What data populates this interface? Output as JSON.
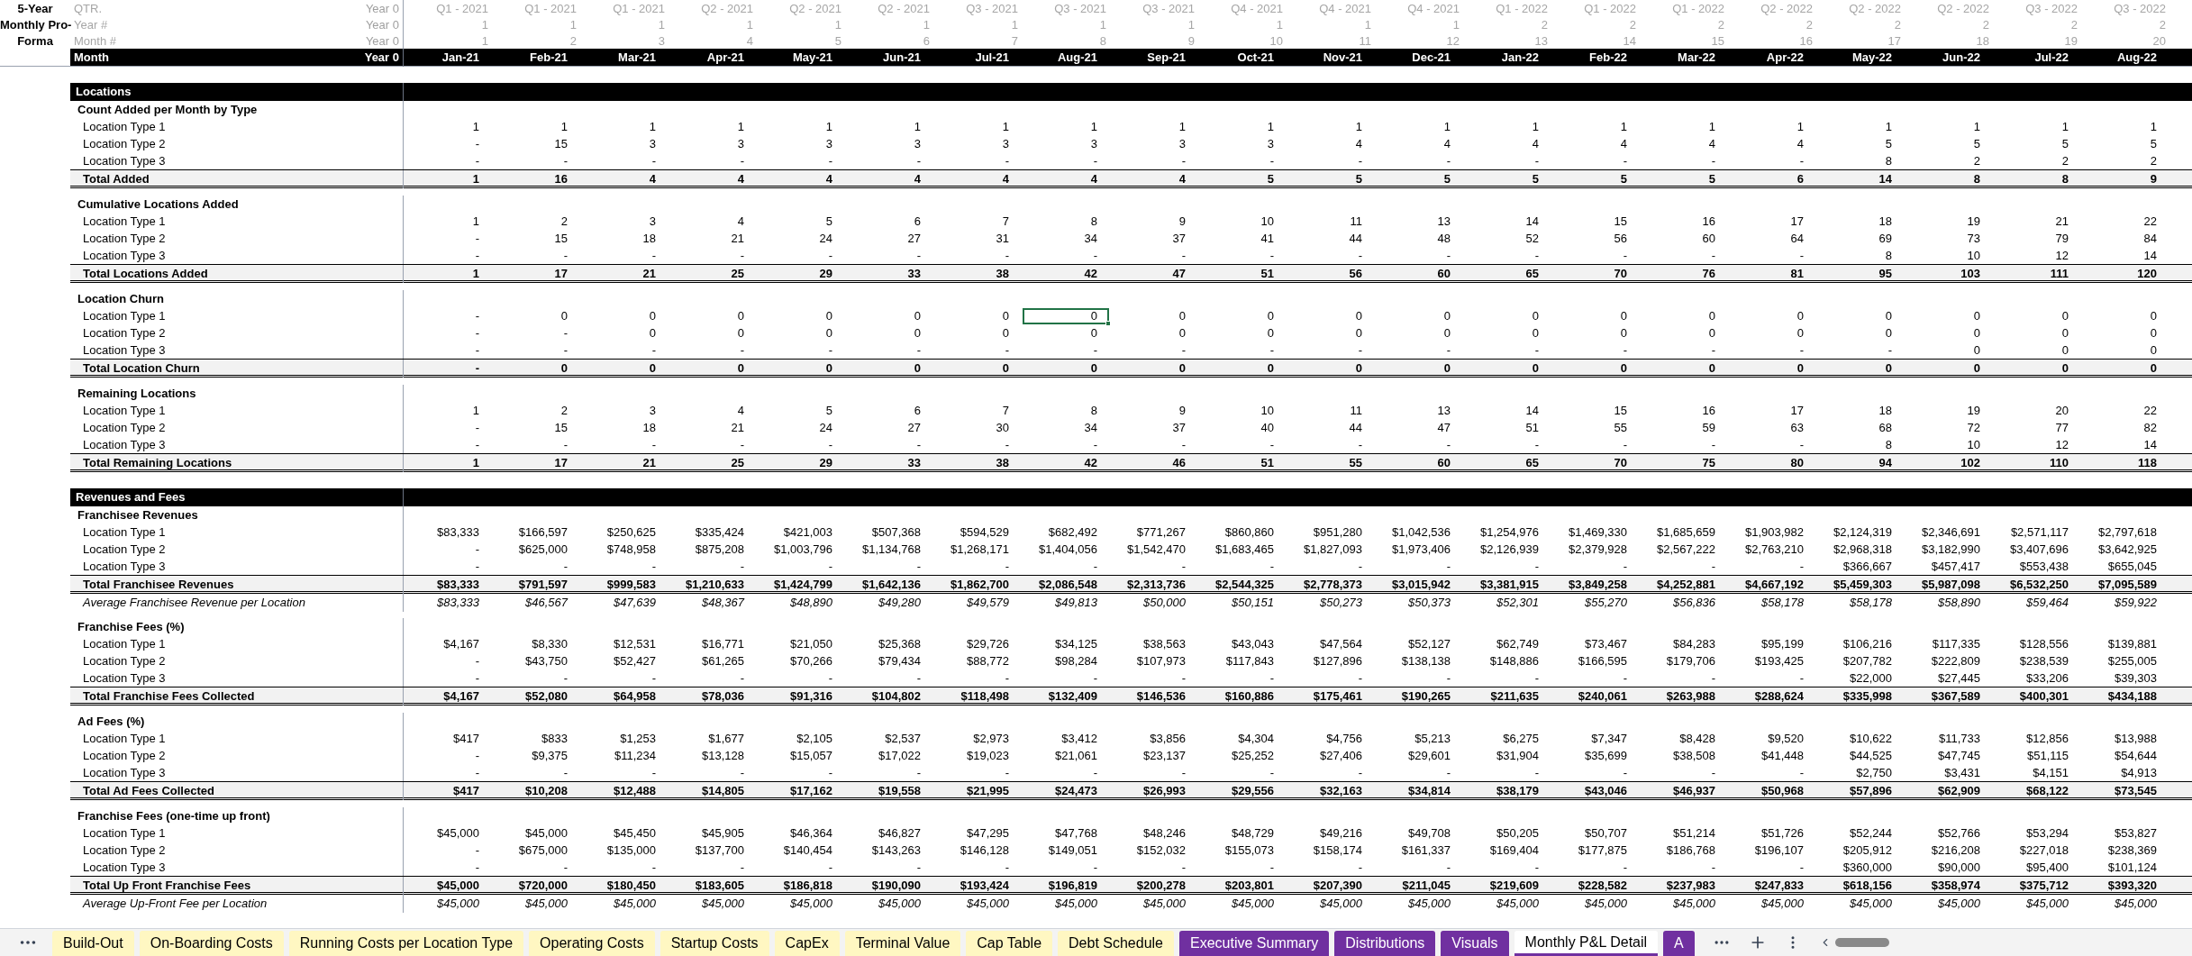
{
  "corner_title": [
    "5-Year",
    "Monthly Pro-",
    "Forma"
  ],
  "header_rows": [
    {
      "label": "QTR.",
      "year0": "Year 0",
      "values": [
        "Q1 - 2021",
        "Q1 - 2021",
        "Q1 - 2021",
        "Q2 - 2021",
        "Q2 - 2021",
        "Q2 - 2021",
        "Q3 - 2021",
        "Q3 - 2021",
        "Q3 - 2021",
        "Q4 - 2021",
        "Q4 - 2021",
        "Q4 - 2021",
        "Q1 - 2022",
        "Q1 - 2022",
        "Q1 - 2022",
        "Q2 - 2022",
        "Q2 - 2022",
        "Q2 - 2022",
        "Q3 - 2022",
        "Q3 - 2022"
      ]
    },
    {
      "label": "Year #",
      "year0": "Year 0",
      "values": [
        "1",
        "1",
        "1",
        "1",
        "1",
        "1",
        "1",
        "1",
        "1",
        "1",
        "1",
        "1",
        "2",
        "2",
        "2",
        "2",
        "2",
        "2",
        "2",
        "2"
      ]
    },
    {
      "label": "Month #",
      "year0": "Year 0",
      "values": [
        "1",
        "2",
        "3",
        "4",
        "5",
        "6",
        "7",
        "8",
        "9",
        "10",
        "11",
        "12",
        "13",
        "14",
        "15",
        "16",
        "17",
        "18",
        "19",
        "20"
      ]
    }
  ],
  "month_row": {
    "label": "Month",
    "year0": "Year 0",
    "values": [
      "Jan-21",
      "Feb-21",
      "Mar-21",
      "Apr-21",
      "May-21",
      "Jun-21",
      "Jul-21",
      "Aug-21",
      "Sep-21",
      "Oct-21",
      "Nov-21",
      "Dec-21",
      "Jan-22",
      "Feb-22",
      "Mar-22",
      "Apr-22",
      "May-22",
      "Jun-22",
      "Jul-22",
      "Aug-22"
    ]
  },
  "sections": [
    {
      "title": "Locations",
      "groups": [
        {
          "title": "Count Added per Month by Type",
          "rows": [
            {
              "kind": "item",
              "label": "Location Type 1",
              "values": [
                "1",
                "1",
                "1",
                "1",
                "1",
                "1",
                "1",
                "1",
                "1",
                "1",
                "1",
                "1",
                "1",
                "1",
                "1",
                "1",
                "1",
                "1",
                "1",
                "1"
              ]
            },
            {
              "kind": "item",
              "label": "Location Type 2",
              "values": [
                "-",
                "15",
                "3",
                "3",
                "3",
                "3",
                "3",
                "3",
                "3",
                "3",
                "4",
                "4",
                "4",
                "4",
                "4",
                "4",
                "5",
                "5",
                "5",
                "5"
              ]
            },
            {
              "kind": "item",
              "label": "Location Type 3",
              "values": [
                "-",
                "-",
                "-",
                "-",
                "-",
                "-",
                "-",
                "-",
                "-",
                "-",
                "-",
                "-",
                "-",
                "-",
                "-",
                "-",
                "8",
                "2",
                "2",
                "2"
              ]
            },
            {
              "kind": "total",
              "label": "Total Added",
              "values": [
                "1",
                "16",
                "4",
                "4",
                "4",
                "4",
                "4",
                "4",
                "4",
                "5",
                "5",
                "5",
                "5",
                "5",
                "5",
                "6",
                "14",
                "8",
                "8",
                "9"
              ]
            }
          ]
        },
        {
          "title": "Cumulative Locations Added",
          "rows": [
            {
              "kind": "item",
              "label": "Location Type 1",
              "values": [
                "1",
                "2",
                "3",
                "4",
                "5",
                "6",
                "7",
                "8",
                "9",
                "10",
                "11",
                "13",
                "14",
                "15",
                "16",
                "17",
                "18",
                "19",
                "21",
                "22"
              ]
            },
            {
              "kind": "item",
              "label": "Location Type 2",
              "values": [
                "-",
                "15",
                "18",
                "21",
                "24",
                "27",
                "31",
                "34",
                "37",
                "41",
                "44",
                "48",
                "52",
                "56",
                "60",
                "64",
                "69",
                "73",
                "79",
                "84"
              ]
            },
            {
              "kind": "item",
              "label": "Location Type 3",
              "values": [
                "-",
                "-",
                "-",
                "-",
                "-",
                "-",
                "-",
                "-",
                "-",
                "-",
                "-",
                "-",
                "-",
                "-",
                "-",
                "-",
                "8",
                "10",
                "12",
                "14"
              ]
            },
            {
              "kind": "total",
              "label": "Total Locations Added",
              "values": [
                "1",
                "17",
                "21",
                "25",
                "29",
                "33",
                "38",
                "42",
                "47",
                "51",
                "56",
                "60",
                "65",
                "70",
                "76",
                "81",
                "95",
                "103",
                "111",
                "120"
              ]
            }
          ]
        },
        {
          "title": "Location Churn",
          "rows": [
            {
              "kind": "item",
              "label": "Location Type 1",
              "values": [
                "-",
                "0",
                "0",
                "0",
                "0",
                "0",
                "0",
                "0",
                "0",
                "0",
                "0",
                "0",
                "0",
                "0",
                "0",
                "0",
                "0",
                "0",
                "0",
                "0"
              ],
              "selected_cells": [
                false,
                false,
                false,
                false,
                false,
                false,
                false,
                true,
                false,
                false,
                false,
                false,
                false,
                false,
                false,
                false,
                false,
                false,
                false,
                false
              ]
            },
            {
              "kind": "item",
              "label": "Location Type 2",
              "values": [
                "-",
                "-",
                "0",
                "0",
                "0",
                "0",
                "0",
                "0",
                "0",
                "0",
                "0",
                "0",
                "0",
                "0",
                "0",
                "0",
                "0",
                "0",
                "0",
                "0"
              ]
            },
            {
              "kind": "item",
              "label": "Location Type 3",
              "values": [
                "-",
                "-",
                "-",
                "-",
                "-",
                "-",
                "-",
                "-",
                "-",
                "-",
                "-",
                "-",
                "-",
                "-",
                "-",
                "-",
                "-",
                "0",
                "0",
                "0"
              ]
            },
            {
              "kind": "total",
              "label": "Total Location Churn",
              "values": [
                "-",
                "0",
                "0",
                "0",
                "0",
                "0",
                "0",
                "0",
                "0",
                "0",
                "0",
                "0",
                "0",
                "0",
                "0",
                "0",
                "0",
                "0",
                "0",
                "0"
              ]
            }
          ]
        },
        {
          "title": "Remaining Locations",
          "rows": [
            {
              "kind": "item",
              "label": "Location Type 1",
              "values": [
                "1",
                "2",
                "3",
                "4",
                "5",
                "6",
                "7",
                "8",
                "9",
                "10",
                "11",
                "13",
                "14",
                "15",
                "16",
                "17",
                "18",
                "19",
                "20",
                "22"
              ]
            },
            {
              "kind": "item",
              "label": "Location Type 2",
              "values": [
                "-",
                "15",
                "18",
                "21",
                "24",
                "27",
                "30",
                "34",
                "37",
                "40",
                "44",
                "47",
                "51",
                "55",
                "59",
                "63",
                "68",
                "72",
                "77",
                "82"
              ]
            },
            {
              "kind": "item",
              "label": "Location Type 3",
              "values": [
                "-",
                "-",
                "-",
                "-",
                "-",
                "-",
                "-",
                "-",
                "-",
                "-",
                "-",
                "-",
                "-",
                "-",
                "-",
                "-",
                "8",
                "10",
                "12",
                "14"
              ]
            },
            {
              "kind": "total",
              "label": "Total Remaining Locations",
              "values": [
                "1",
                "17",
                "21",
                "25",
                "29",
                "33",
                "38",
                "42",
                "46",
                "51",
                "55",
                "60",
                "65",
                "70",
                "75",
                "80",
                "94",
                "102",
                "110",
                "118"
              ]
            }
          ]
        }
      ]
    },
    {
      "title": "Revenues and Fees",
      "groups": [
        {
          "title": "Franchisee Revenues",
          "rows": [
            {
              "kind": "item",
              "label": "Location Type 1",
              "values": [
                "$83,333",
                "$166,597",
                "$250,625",
                "$335,424",
                "$421,003",
                "$507,368",
                "$594,529",
                "$682,492",
                "$771,267",
                "$860,860",
                "$951,280",
                "$1,042,536",
                "$1,254,976",
                "$1,469,330",
                "$1,685,659",
                "$1,903,982",
                "$2,124,319",
                "$2,346,691",
                "$2,571,117",
                "$2,797,618"
              ]
            },
            {
              "kind": "item",
              "label": "Location Type 2",
              "values": [
                "-",
                "$625,000",
                "$748,958",
                "$875,208",
                "$1,003,796",
                "$1,134,768",
                "$1,268,171",
                "$1,404,056",
                "$1,542,470",
                "$1,683,465",
                "$1,827,093",
                "$1,973,406",
                "$2,126,939",
                "$2,379,928",
                "$2,567,222",
                "$2,763,210",
                "$2,968,318",
                "$3,182,990",
                "$3,407,696",
                "$3,642,925"
              ]
            },
            {
              "kind": "item",
              "label": "Location Type 3",
              "values": [
                "-",
                "-",
                "-",
                "-",
                "-",
                "-",
                "-",
                "-",
                "-",
                "-",
                "-",
                "-",
                "-",
                "-",
                "-",
                "-",
                "$366,667",
                "$457,417",
                "$553,438",
                "$655,045"
              ]
            },
            {
              "kind": "total",
              "label": "Total Franchisee Revenues",
              "values": [
                "$83,333",
                "$791,597",
                "$999,583",
                "$1,210,633",
                "$1,424,799",
                "$1,642,136",
                "$1,862,700",
                "$2,086,548",
                "$2,313,736",
                "$2,544,325",
                "$2,778,373",
                "$3,015,942",
                "$3,381,915",
                "$3,849,258",
                "$4,252,881",
                "$4,667,192",
                "$5,459,303",
                "$5,987,098",
                "$6,532,250",
                "$7,095,589"
              ]
            },
            {
              "kind": "average",
              "label": "Average Franchisee Revenue per Location",
              "values": [
                "$83,333",
                "$46,567",
                "$47,639",
                "$48,367",
                "$48,890",
                "$49,280",
                "$49,579",
                "$49,813",
                "$50,000",
                "$50,151",
                "$50,273",
                "$50,373",
                "$52,301",
                "$55,270",
                "$56,836",
                "$58,178",
                "$58,178",
                "$58,890",
                "$59,464",
                "$59,922"
              ]
            }
          ]
        },
        {
          "title": "Franchise Fees (%)",
          "rows": [
            {
              "kind": "item",
              "label": "Location Type 1",
              "values": [
                "$4,167",
                "$8,330",
                "$12,531",
                "$16,771",
                "$21,050",
                "$25,368",
                "$29,726",
                "$34,125",
                "$38,563",
                "$43,043",
                "$47,564",
                "$52,127",
                "$62,749",
                "$73,467",
                "$84,283",
                "$95,199",
                "$106,216",
                "$117,335",
                "$128,556",
                "$139,881"
              ]
            },
            {
              "kind": "item",
              "label": "Location Type 2",
              "values": [
                "-",
                "$43,750",
                "$52,427",
                "$61,265",
                "$70,266",
                "$79,434",
                "$88,772",
                "$98,284",
                "$107,973",
                "$117,843",
                "$127,896",
                "$138,138",
                "$148,886",
                "$166,595",
                "$179,706",
                "$193,425",
                "$207,782",
                "$222,809",
                "$238,539",
                "$255,005"
              ]
            },
            {
              "kind": "item",
              "label": "Location Type 3",
              "values": [
                "-",
                "-",
                "-",
                "-",
                "-",
                "-",
                "-",
                "-",
                "-",
                "-",
                "-",
                "-",
                "-",
                "-",
                "-",
                "-",
                "$22,000",
                "$27,445",
                "$33,206",
                "$39,303"
              ]
            },
            {
              "kind": "total",
              "label": "Total Franchise Fees Collected",
              "values": [
                "$4,167",
                "$52,080",
                "$64,958",
                "$78,036",
                "$91,316",
                "$104,802",
                "$118,498",
                "$132,409",
                "$146,536",
                "$160,886",
                "$175,461",
                "$190,265",
                "$211,635",
                "$240,061",
                "$263,988",
                "$288,624",
                "$335,998",
                "$367,589",
                "$400,301",
                "$434,188"
              ]
            }
          ]
        },
        {
          "title": "Ad Fees (%)",
          "rows": [
            {
              "kind": "item",
              "label": "Location Type 1",
              "values": [
                "$417",
                "$833",
                "$1,253",
                "$1,677",
                "$2,105",
                "$2,537",
                "$2,973",
                "$3,412",
                "$3,856",
                "$4,304",
                "$4,756",
                "$5,213",
                "$6,275",
                "$7,347",
                "$8,428",
                "$9,520",
                "$10,622",
                "$11,733",
                "$12,856",
                "$13,988"
              ]
            },
            {
              "kind": "item",
              "label": "Location Type 2",
              "values": [
                "-",
                "$9,375",
                "$11,234",
                "$13,128",
                "$15,057",
                "$17,022",
                "$19,023",
                "$21,061",
                "$23,137",
                "$25,252",
                "$27,406",
                "$29,601",
                "$31,904",
                "$35,699",
                "$38,508",
                "$41,448",
                "$44,525",
                "$47,745",
                "$51,115",
                "$54,644"
              ]
            },
            {
              "kind": "item",
              "label": "Location Type 3",
              "values": [
                "-",
                "-",
                "-",
                "-",
                "-",
                "-",
                "-",
                "-",
                "-",
                "-",
                "-",
                "-",
                "-",
                "-",
                "-",
                "-",
                "$2,750",
                "$3,431",
                "$4,151",
                "$4,913"
              ]
            },
            {
              "kind": "total",
              "label": "Total Ad Fees Collected",
              "values": [
                "$417",
                "$10,208",
                "$12,488",
                "$14,805",
                "$17,162",
                "$19,558",
                "$21,995",
                "$24,473",
                "$26,993",
                "$29,556",
                "$32,163",
                "$34,814",
                "$38,179",
                "$43,046",
                "$46,937",
                "$50,968",
                "$57,896",
                "$62,909",
                "$68,122",
                "$73,545"
              ]
            }
          ]
        },
        {
          "title": "Franchise Fees (one-time up front)",
          "rows": [
            {
              "kind": "item",
              "label": "Location Type 1",
              "values": [
                "$45,000",
                "$45,000",
                "$45,450",
                "$45,905",
                "$46,364",
                "$46,827",
                "$47,295",
                "$47,768",
                "$48,246",
                "$48,729",
                "$49,216",
                "$49,708",
                "$50,205",
                "$50,707",
                "$51,214",
                "$51,726",
                "$52,244",
                "$52,766",
                "$53,294",
                "$53,827"
              ]
            },
            {
              "kind": "item",
              "label": "Location Type 2",
              "values": [
                "-",
                "$675,000",
                "$135,000",
                "$137,700",
                "$140,454",
                "$143,263",
                "$146,128",
                "$149,051",
                "$152,032",
                "$155,073",
                "$158,174",
                "$161,337",
                "$169,404",
                "$177,875",
                "$186,768",
                "$196,107",
                "$205,912",
                "$216,208",
                "$227,018",
                "$238,369"
              ]
            },
            {
              "kind": "item",
              "label": "Location Type 3",
              "values": [
                "-",
                "-",
                "-",
                "-",
                "-",
                "-",
                "-",
                "-",
                "-",
                "-",
                "-",
                "-",
                "-",
                "-",
                "-",
                "-",
                "$360,000",
                "$90,000",
                "$95,400",
                "$101,124"
              ]
            },
            {
              "kind": "total",
              "label": "Total Up Front Franchise Fees",
              "values": [
                "$45,000",
                "$720,000",
                "$180,450",
                "$183,605",
                "$186,818",
                "$190,090",
                "$193,424",
                "$196,819",
                "$200,278",
                "$203,801",
                "$207,390",
                "$211,045",
                "$219,609",
                "$228,582",
                "$237,983",
                "$247,833",
                "$618,156",
                "$358,974",
                "$375,712",
                "$393,320"
              ]
            },
            {
              "kind": "average",
              "label": "Average Up-Front Fee per Location",
              "values": [
                "$45,000",
                "$45,000",
                "$45,000",
                "$45,000",
                "$45,000",
                "$45,000",
                "$45,000",
                "$45,000",
                "$45,000",
                "$45,000",
                "$45,000",
                "$45,000",
                "$45,000",
                "$45,000",
                "$45,000",
                "$45,000",
                "$45,000",
                "$45,000",
                "$45,000",
                "$45,000"
              ]
            }
          ]
        }
      ]
    }
  ],
  "sheet_tabs": [
    {
      "label": "Build-Out",
      "color": "#fff7c2",
      "selected": false
    },
    {
      "label": "On-Boarding Costs",
      "color": "#fff7c2",
      "selected": false
    },
    {
      "label": "Running Costs per Location Type",
      "color": "#fff7c2",
      "selected": false
    },
    {
      "label": "Operating Costs",
      "color": "#fff7c2",
      "selected": false
    },
    {
      "label": "Startup Costs",
      "color": "#fff7c2",
      "selected": false
    },
    {
      "label": "CapEx",
      "color": "#fff7c2",
      "selected": false
    },
    {
      "label": "Terminal Value",
      "color": "#fff7c2",
      "selected": false
    },
    {
      "label": "Cap Table",
      "color": "#fff7c2",
      "selected": false
    },
    {
      "label": "Debt Schedule",
      "color": "#fff7c2",
      "selected": false
    },
    {
      "label": "Executive Summary",
      "color": "#7030a0",
      "selected": false
    },
    {
      "label": "Distributions",
      "color": "#7030a0",
      "selected": false
    },
    {
      "label": "Visuals",
      "color": "#7030a0",
      "selected": false
    },
    {
      "label": "Monthly P&L Detail",
      "color": "#7030a0",
      "selected": true
    },
    {
      "label": "A",
      "color": "#7030a0",
      "selected": false
    }
  ]
}
